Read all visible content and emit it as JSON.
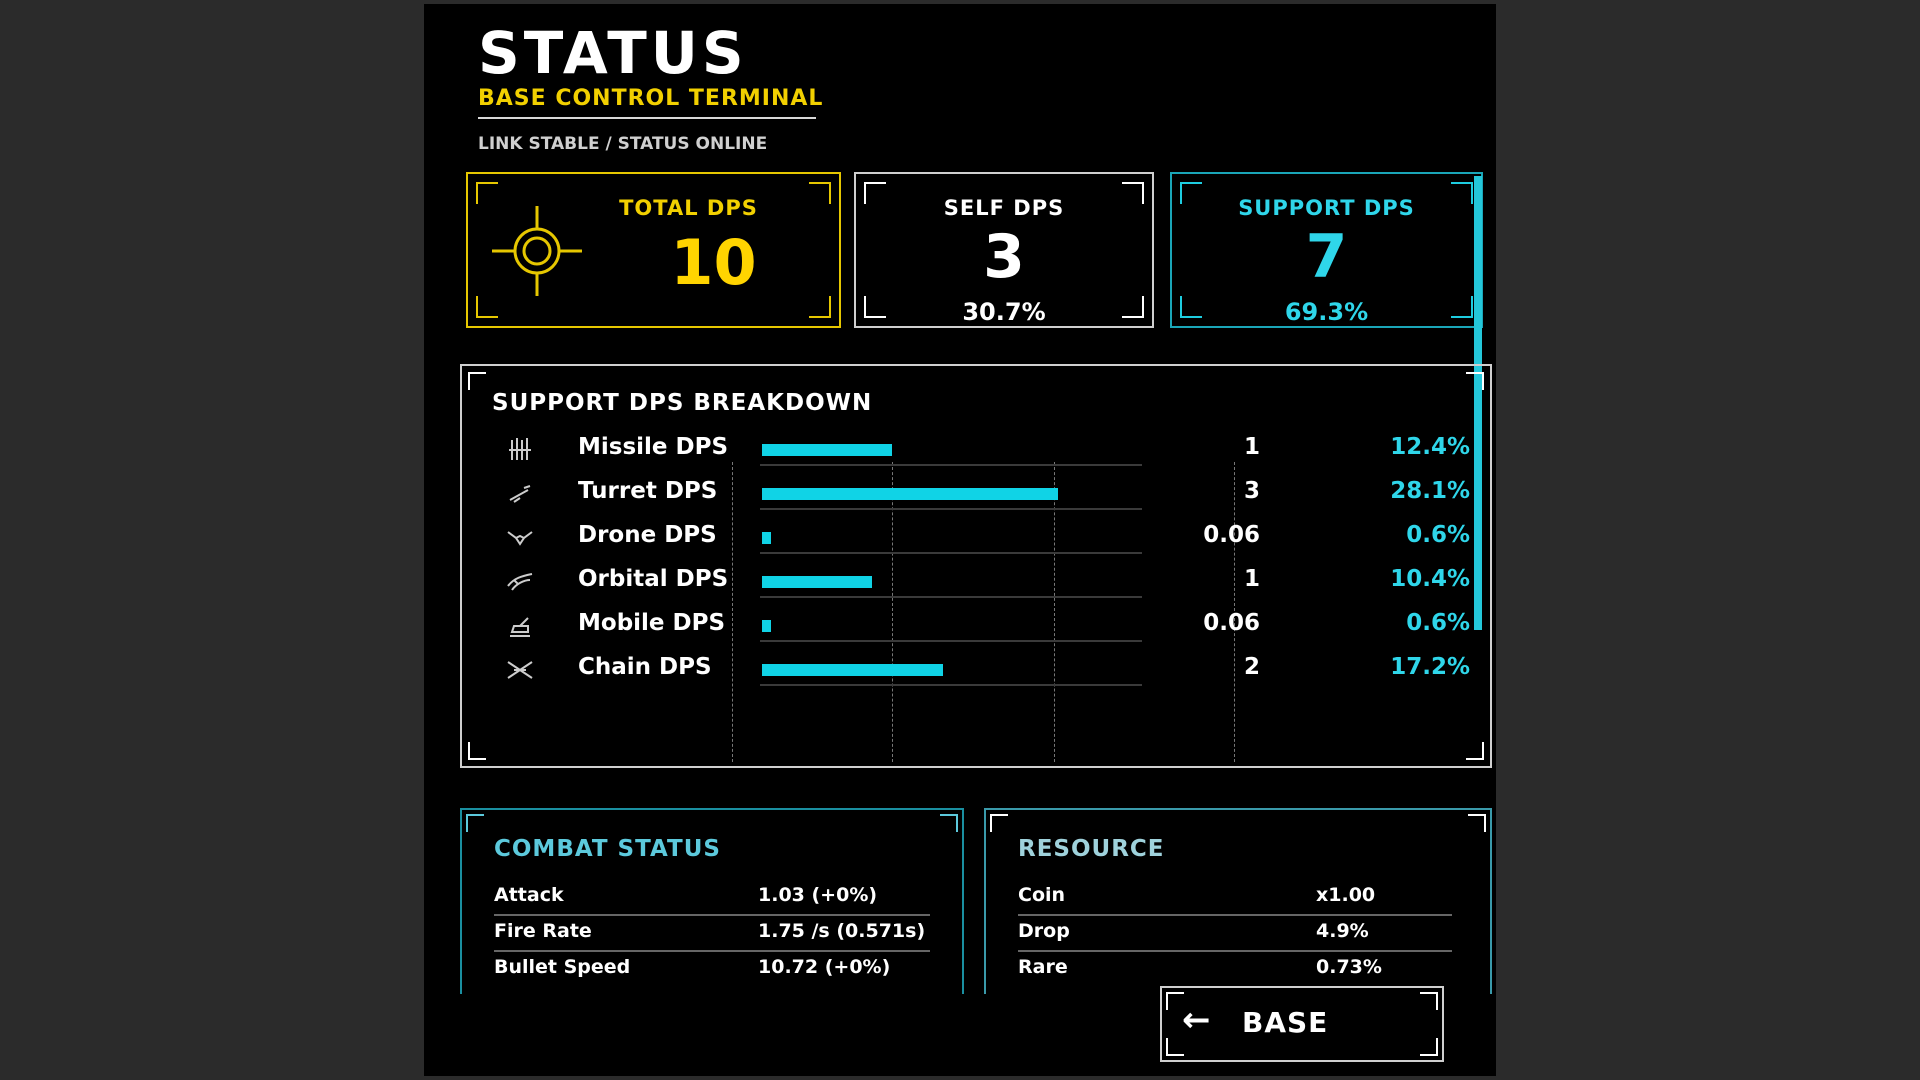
{
  "header": {
    "title": "STATUS",
    "subtitle": "BASE CONTROL TERMINAL",
    "status_line": "LINK STABLE / STATUS ONLINE"
  },
  "cards": {
    "total": {
      "label": "TOTAL DPS",
      "value": "10"
    },
    "self": {
      "label": "SELF DPS",
      "value": "3",
      "pct": "30.7%"
    },
    "support": {
      "label": "SUPPORT DPS",
      "value": "7",
      "pct": "69.3%"
    }
  },
  "breakdown": {
    "title": "SUPPORT DPS BREAKDOWN",
    "rows": [
      {
        "name": "Missile DPS",
        "value": "1",
        "pct": "12.4%",
        "fraction": 0.44,
        "icon": "missile-icon"
      },
      {
        "name": "Turret DPS",
        "value": "3",
        "pct": "28.1%",
        "fraction": 1.0,
        "icon": "turret-icon"
      },
      {
        "name": "Drone DPS",
        "value": "0.06",
        "pct": "0.6%",
        "fraction": 0.03,
        "icon": "drone-icon"
      },
      {
        "name": "Orbital DPS",
        "value": "1",
        "pct": "10.4%",
        "fraction": 0.37,
        "icon": "orbital-icon"
      },
      {
        "name": "Mobile DPS",
        "value": "0.06",
        "pct": "0.6%",
        "fraction": 0.03,
        "icon": "mobile-icon"
      },
      {
        "name": "Chain DPS",
        "value": "2",
        "pct": "17.2%",
        "fraction": 0.61,
        "icon": "chain-icon"
      }
    ]
  },
  "combat": {
    "title": "COMBAT STATUS",
    "stats": [
      {
        "key": "Attack",
        "value": "1.03 (+0%)"
      },
      {
        "key": "Fire Rate",
        "value": "1.75 /s (0.571s)"
      },
      {
        "key": "Bullet Speed",
        "value": "10.72 (+0%)"
      }
    ]
  },
  "resource": {
    "title": "RESOURCE",
    "stats": [
      {
        "key": "Coin",
        "value": "x1.00"
      },
      {
        "key": "Drop",
        "value": "4.9%"
      },
      {
        "key": "Rare",
        "value": "0.73%"
      }
    ]
  },
  "base_button": {
    "arrow": "←",
    "label": "BASE"
  },
  "colors": {
    "accent_yellow": "#f2d000",
    "accent_cyan": "#10d3e6"
  }
}
